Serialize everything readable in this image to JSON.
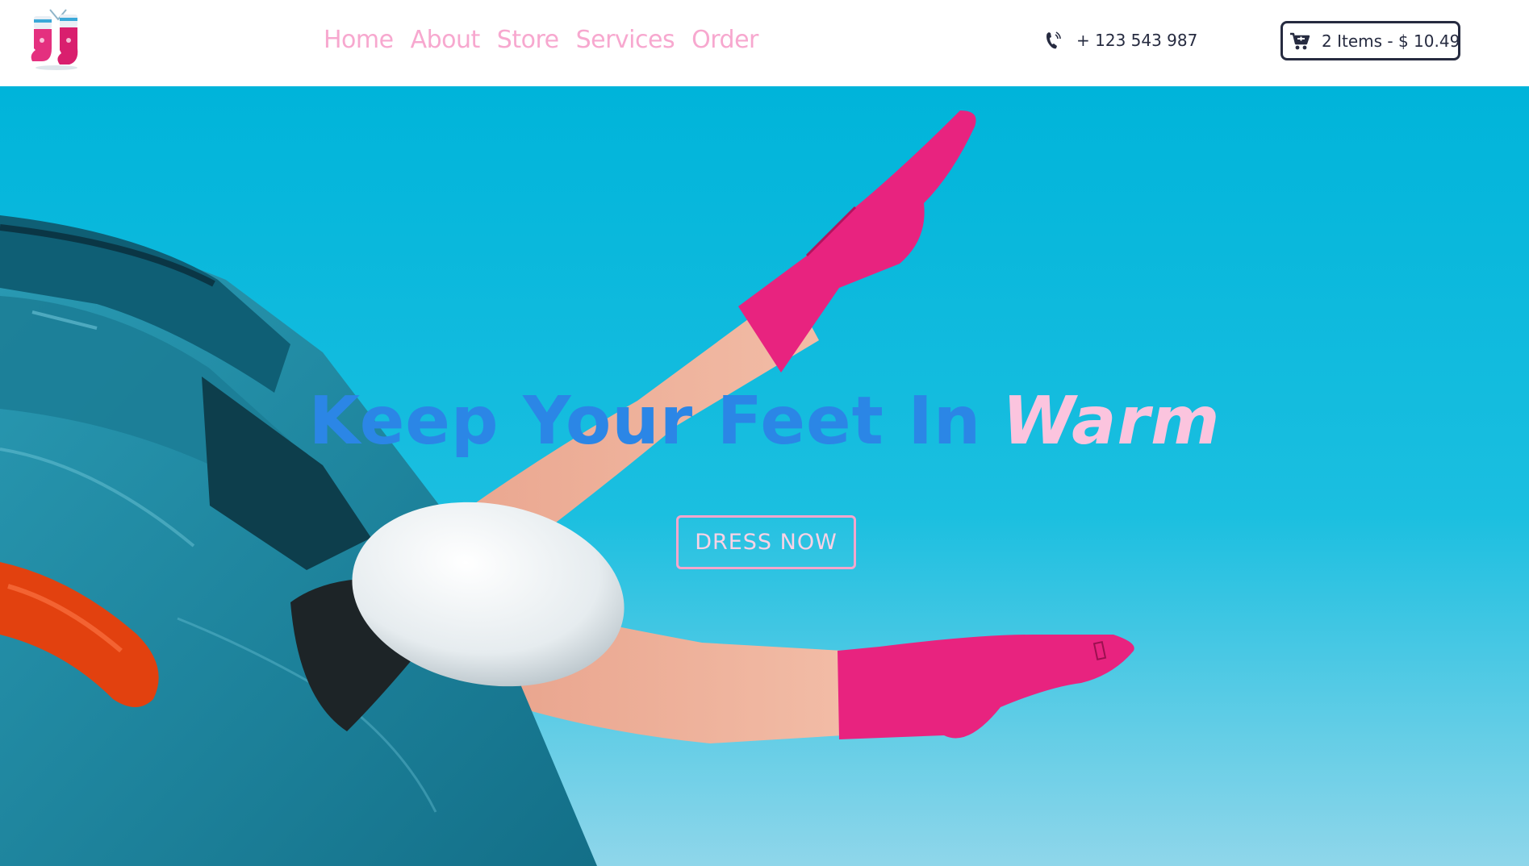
{
  "header": {
    "logo_icon": "socks-logo-icon",
    "nav": [
      {
        "label": "Home"
      },
      {
        "label": "About"
      },
      {
        "label": "Store"
      },
      {
        "label": "Services"
      },
      {
        "label": "Order"
      }
    ],
    "phone": {
      "icon": "phone-icon",
      "number": "+ 123 543 987"
    },
    "cart": {
      "icon": "cart-icon",
      "label": "2 Items - $ 10.49"
    }
  },
  "hero": {
    "headline_lead": "Keep Your Feet In",
    "headline_accent": "Warm",
    "cta_label": "DRESS NOW",
    "background_image": "legs-in-pink-socks-out-of-car-window"
  },
  "colors": {
    "nav_text": "#f7a8cf",
    "header_text": "#262b40",
    "headline_blue": "#2b86e6",
    "headline_pink": "#fbc4de",
    "sky": "#00b6db",
    "sock_pink": "#e8237f",
    "car_teal": "#1e8fa8"
  }
}
